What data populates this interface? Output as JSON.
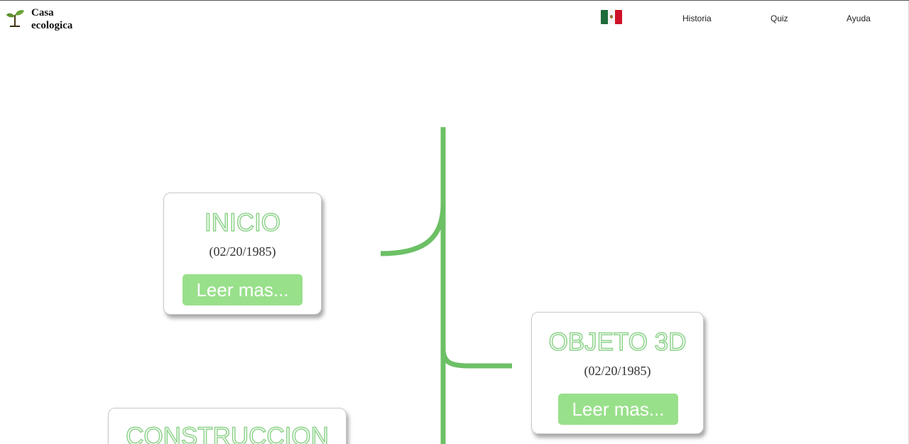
{
  "header": {
    "logo_line1": "Casa",
    "logo_line2": "ecologica",
    "logo_icon": "sprout-icon",
    "language_flag": "mexico-flag-icon",
    "nav": [
      {
        "label": "Historia"
      },
      {
        "label": "Quiz"
      },
      {
        "label": "Ayuda"
      }
    ]
  },
  "timeline": {
    "line_color": "#6cc065",
    "events": [
      {
        "title": "INICIO",
        "date": "(02/20/1985)",
        "button": "Leer mas..."
      },
      {
        "title": "OBJETO 3D",
        "date": "(02/20/1985)",
        "button": "Leer mas..."
      },
      {
        "title": "CONSTRUCCION"
      }
    ]
  },
  "colors": {
    "accent_green": "#99e08b",
    "title_outline": "#8ed38b"
  }
}
